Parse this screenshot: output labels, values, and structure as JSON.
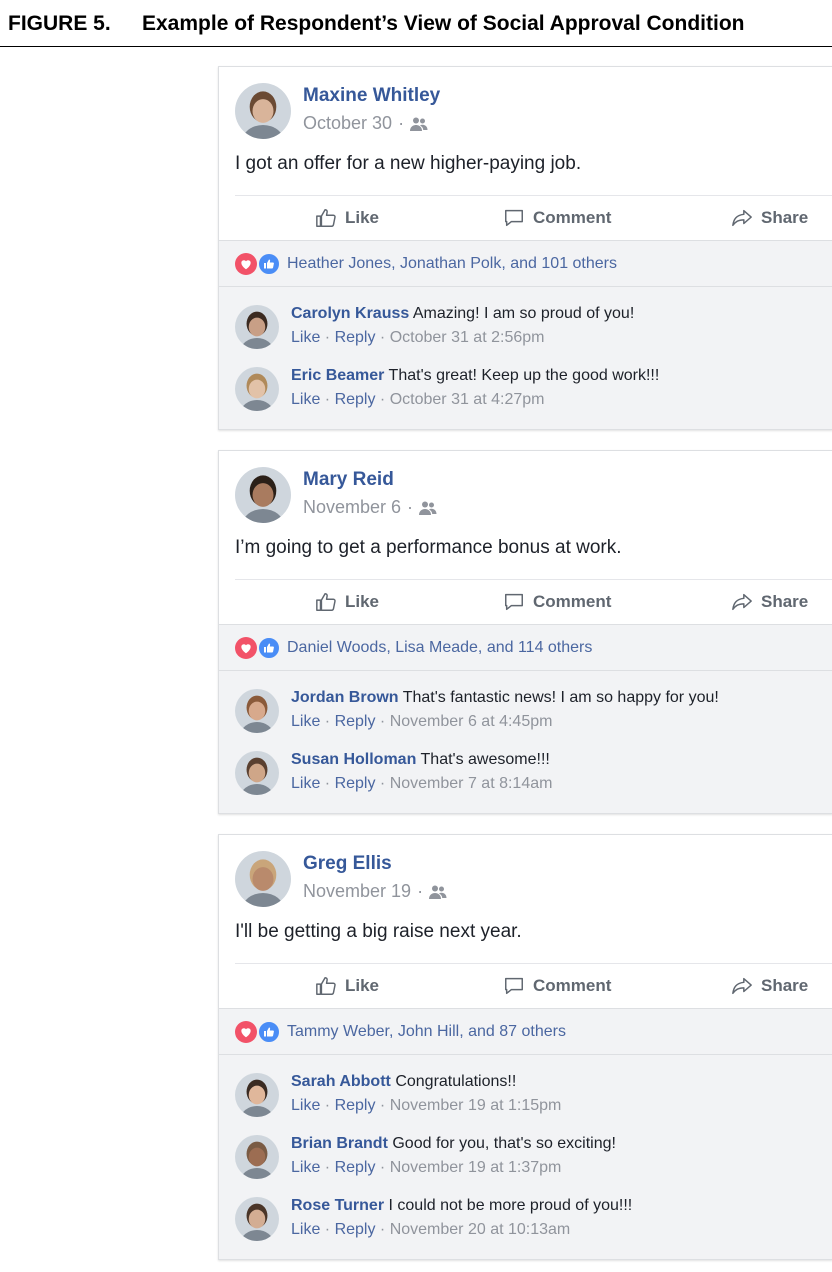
{
  "figure": {
    "number": "FIGURE 5.",
    "title": "Example of Respondent’s View of Social Approval Condition"
  },
  "actions": {
    "like": "Like",
    "comment": "Comment",
    "share": "Share"
  },
  "comment_actions": {
    "like": "Like",
    "reply": "Reply",
    "sep": " · "
  },
  "date_suffix": " ·",
  "colors": {
    "name_blue": "#365899",
    "love": "#f25268",
    "like_blue": "#4a8df6",
    "panel": "#f2f3f5"
  },
  "posts": [
    {
      "author": "Maxine Whitley",
      "date": "October 30",
      "text": "I got an offer for a new higher-paying job.",
      "reactors": "Heather Jones, Jonathan Polk, and 101 others",
      "comments": [
        {
          "name": "Carolyn Krauss",
          "text": "Amazing! I am so proud of you!",
          "time": "October 31 at 2:56pm"
        },
        {
          "name": "Eric Beamer",
          "text": "That's great! Keep up the good work!!!",
          "time": "October 31 at 4:27pm"
        }
      ]
    },
    {
      "author": "Mary Reid",
      "date": "November 6",
      "text": "I’m going to get a performance bonus at work.",
      "reactors": "Daniel Woods, Lisa Meade, and 114 others",
      "comments": [
        {
          "name": "Jordan Brown",
          "text": "That's fantastic news! I am so happy for you!",
          "time": "November 6 at 4:45pm"
        },
        {
          "name": "Susan Holloman",
          "text": "That's awesome!!!",
          "time": "November 7 at 8:14am"
        }
      ]
    },
    {
      "author": "Greg Ellis",
      "date": "November 19",
      "text": "I'll be getting a big raise next year.",
      "reactors": "Tammy Weber, John Hill, and 87 others",
      "comments": [
        {
          "name": "Sarah Abbott",
          "text": "Congratulations!!",
          "time": "November 19 at 1:15pm"
        },
        {
          "name": "Brian Brandt",
          "text": "Good for you, that's so exciting!",
          "time": "November 19 at 1:37pm"
        },
        {
          "name": "Rose Turner",
          "text": "I could not be more proud of you!!!",
          "time": "November 20 at 10:13am"
        }
      ]
    }
  ]
}
